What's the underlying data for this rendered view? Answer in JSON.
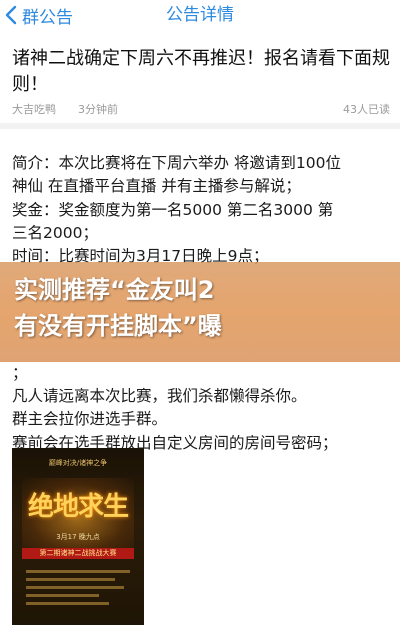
{
  "nav": {
    "back_label": "群公告",
    "title": "公告详情"
  },
  "post": {
    "title": "诸神二战确定下周六不再推迟！报名请看下面规则！",
    "author": "大吉吃鸭",
    "time": "3分钟前",
    "reads": "43人已读"
  },
  "content_lines": [
    "简介：本次比赛将在下周六举办 将邀请到100位",
    "神仙 在直播平台直播 并有主播参与解说；",
    "奖金：奖金额度为第一名5000 第二名3000 第",
    "三名2000；",
    "时间：比赛时间为3月17日晚上9点；",
    "",
    "",
    "",
    "",
    "；",
    "凡人请远离本次比赛，我们杀都懒得杀你。",
    "群主会拉你进选手群。",
    "赛前会在选手群放出自定义房间的房间号密码；"
  ],
  "banner": {
    "line1": "实测推荐“金友叫2",
    "line2": "有没有开挂脚本”曝"
  },
  "poster": {
    "top_text": "巅峰对决/诸神之争",
    "title": "绝地求生",
    "date_text": "3月17 晚九点",
    "ribbon_text": "第二期诸神二战挑战大赛"
  },
  "colors": {
    "accent": "#2d8ae0",
    "banner": "#e09555"
  }
}
